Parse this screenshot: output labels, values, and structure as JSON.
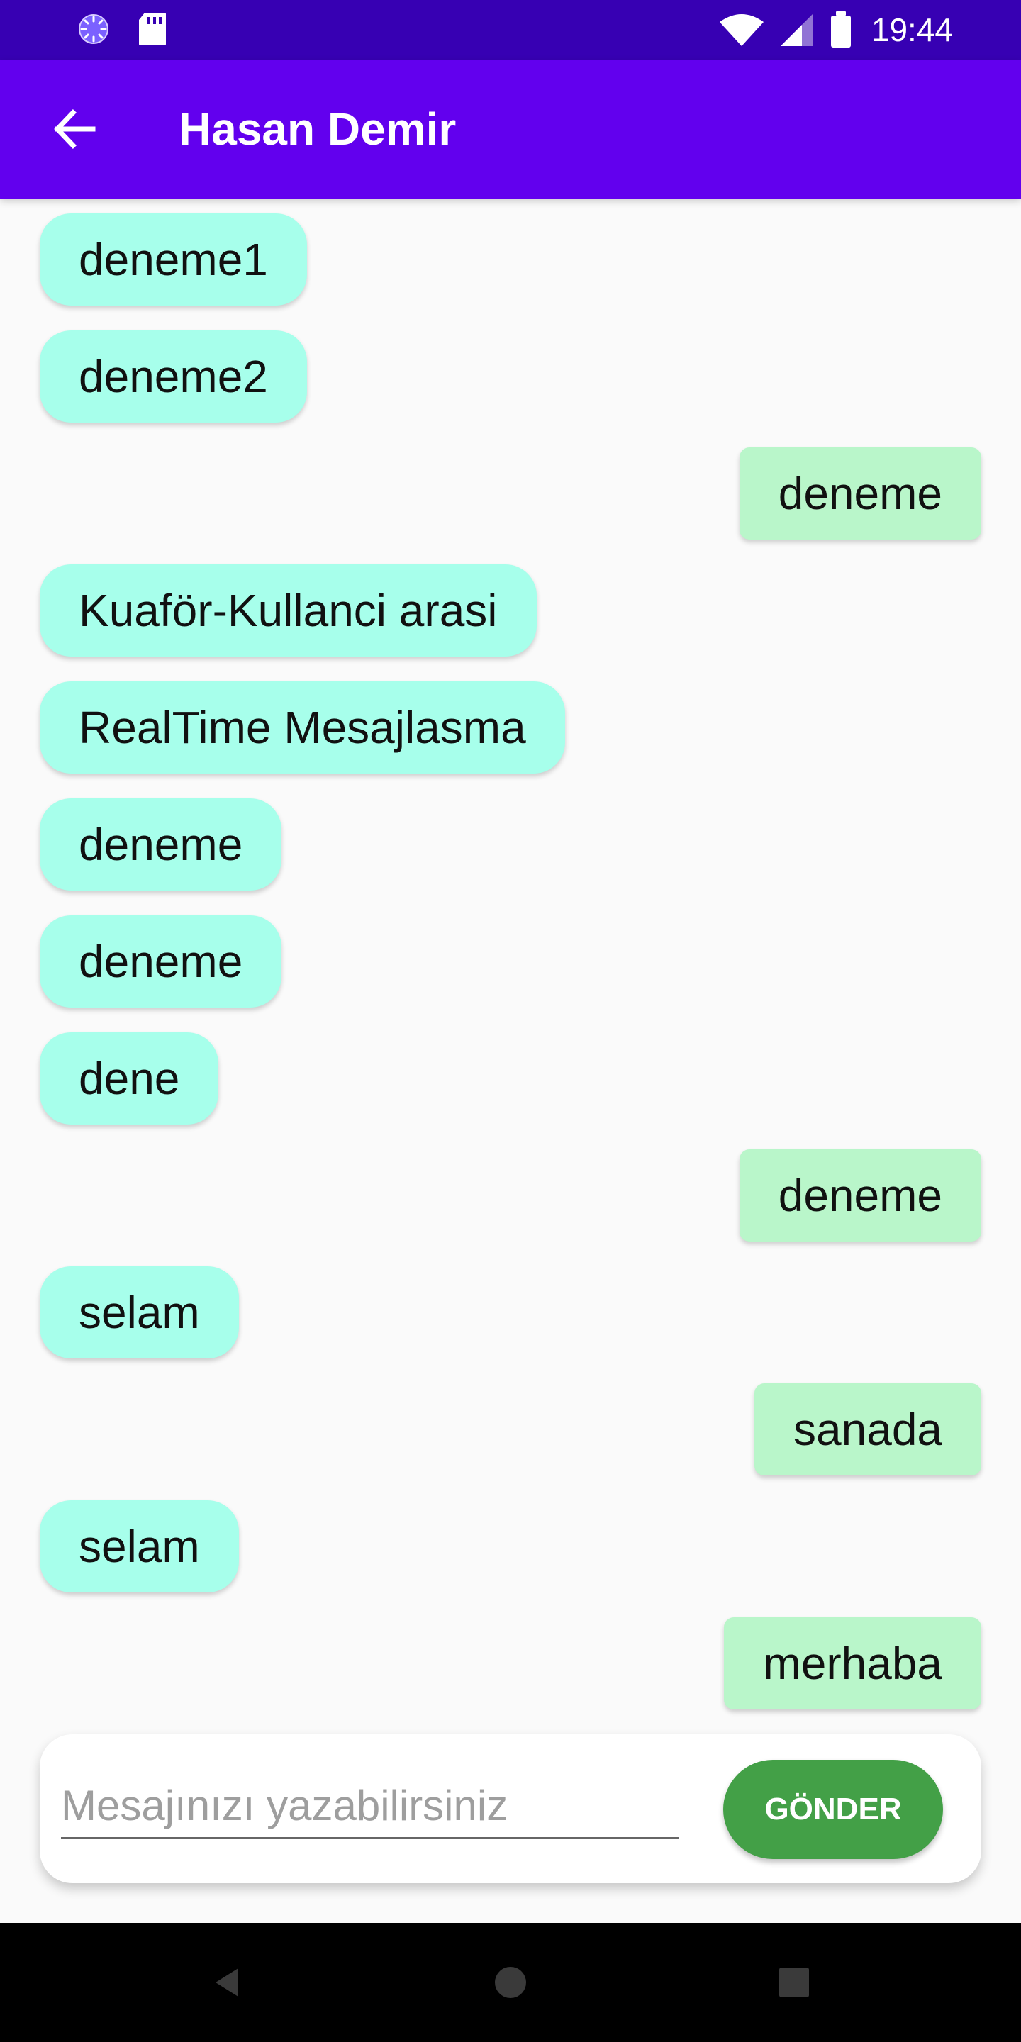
{
  "status_bar": {
    "time": "19:44",
    "left_icons": [
      "loading-icon",
      "sd-card-icon"
    ],
    "right_icons": [
      "wifi-icon",
      "cellular-signal-icon",
      "battery-icon"
    ]
  },
  "header": {
    "title": "Hasan Demir",
    "back_icon": "arrow-back-icon"
  },
  "messages": [
    {
      "text": "deneme1",
      "direction": "incoming"
    },
    {
      "text": "deneme2",
      "direction": "incoming"
    },
    {
      "text": "deneme",
      "direction": "outgoing"
    },
    {
      "text": "Kuaför-Kullanci arasi",
      "direction": "incoming"
    },
    {
      "text": "RealTime Mesajlasma",
      "direction": "incoming"
    },
    {
      "text": "deneme",
      "direction": "incoming"
    },
    {
      "text": "deneme",
      "direction": "incoming"
    },
    {
      "text": "dene",
      "direction": "incoming"
    },
    {
      "text": "deneme",
      "direction": "outgoing"
    },
    {
      "text": "selam",
      "direction": "incoming"
    },
    {
      "text": "sanada",
      "direction": "outgoing"
    },
    {
      "text": "selam",
      "direction": "incoming"
    },
    {
      "text": "merhaba",
      "direction": "outgoing"
    }
  ],
  "composer": {
    "value": "",
    "placeholder": "Mesajınızı yazabilirsiniz",
    "send_label": "GÖNDER"
  },
  "navigation": {
    "buttons": [
      "back-triangle-icon",
      "home-circle-icon",
      "recents-square-icon"
    ]
  },
  "colors": {
    "status_bar": "#3700b3",
    "app_bar": "#6200ee",
    "incoming_bubble": "#a7ffeb",
    "outgoing_bubble": "#b9f6ca",
    "send_button": "#43a047"
  }
}
